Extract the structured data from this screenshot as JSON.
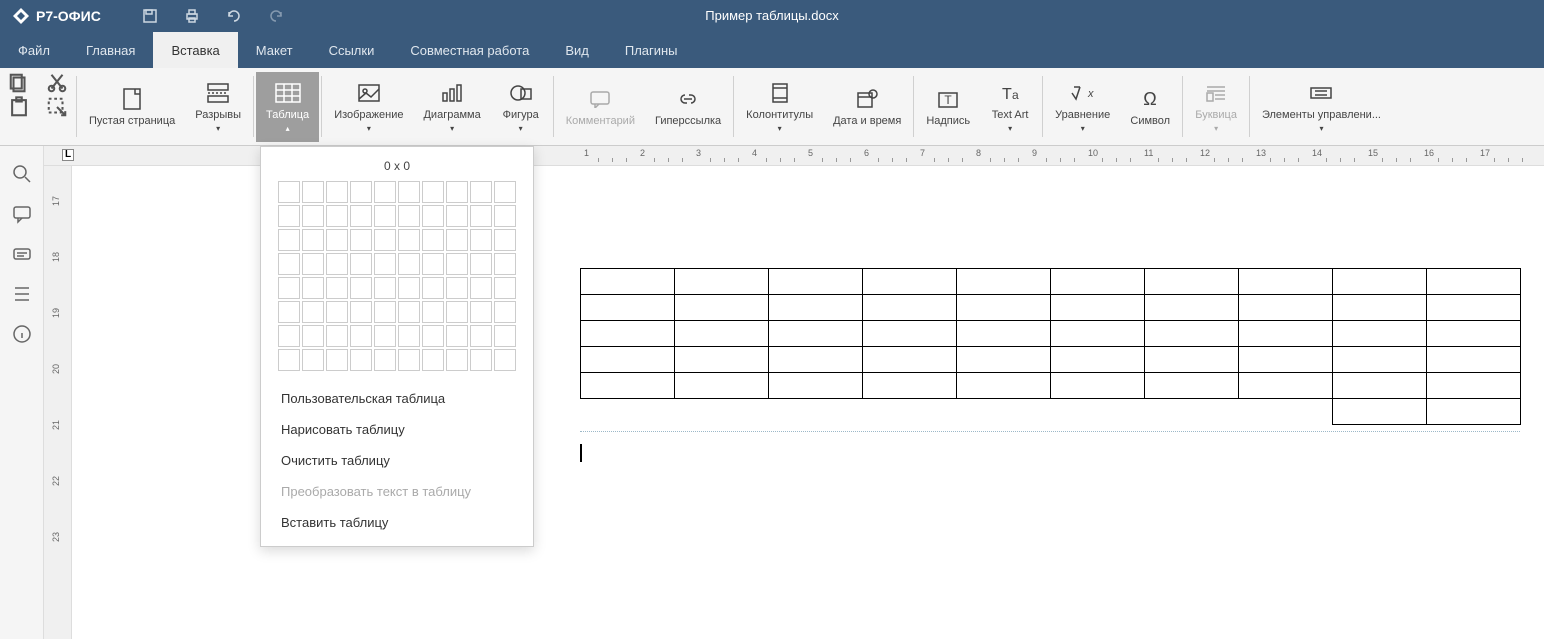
{
  "app": {
    "name": "Р7-ОФИС"
  },
  "document": {
    "title": "Пример таблицы.docx"
  },
  "menu": {
    "items": [
      "Файл",
      "Главная",
      "Вставка",
      "Макет",
      "Ссылки",
      "Совместная работа",
      "Вид",
      "Плагины"
    ],
    "active_index": 2
  },
  "ribbon": {
    "blank_page": "Пустая страница",
    "breaks": "Разрывы",
    "table": "Таблица",
    "image": "Изображение",
    "chart": "Диаграмма",
    "shape": "Фигура",
    "comment": "Комментарий",
    "hyperlink": "Гиперссылка",
    "header_footer": "Колонтитулы",
    "date_time": "Дата и время",
    "textbox": "Надпись",
    "text_art": "Text Art",
    "equation": "Уравнение",
    "symbol": "Символ",
    "dropcap": "Буквица",
    "controls": "Элементы управлени..."
  },
  "table_dropdown": {
    "size_label": "0 x 0",
    "custom": "Пользовательская таблица",
    "draw": "Нарисовать таблицу",
    "erase": "Очистить таблицу",
    "convert": "Преобразовать текст в таблицу",
    "insert": "Вставить таблицу"
  },
  "vruler_labels": [
    "17",
    "18",
    "19",
    "20",
    "21",
    "22",
    "23"
  ],
  "hruler_labels": [
    "1",
    "2",
    "3",
    "4",
    "5",
    "6",
    "7",
    "8",
    "9",
    "10",
    "11",
    "12",
    "13",
    "14",
    "15",
    "16",
    "17"
  ]
}
